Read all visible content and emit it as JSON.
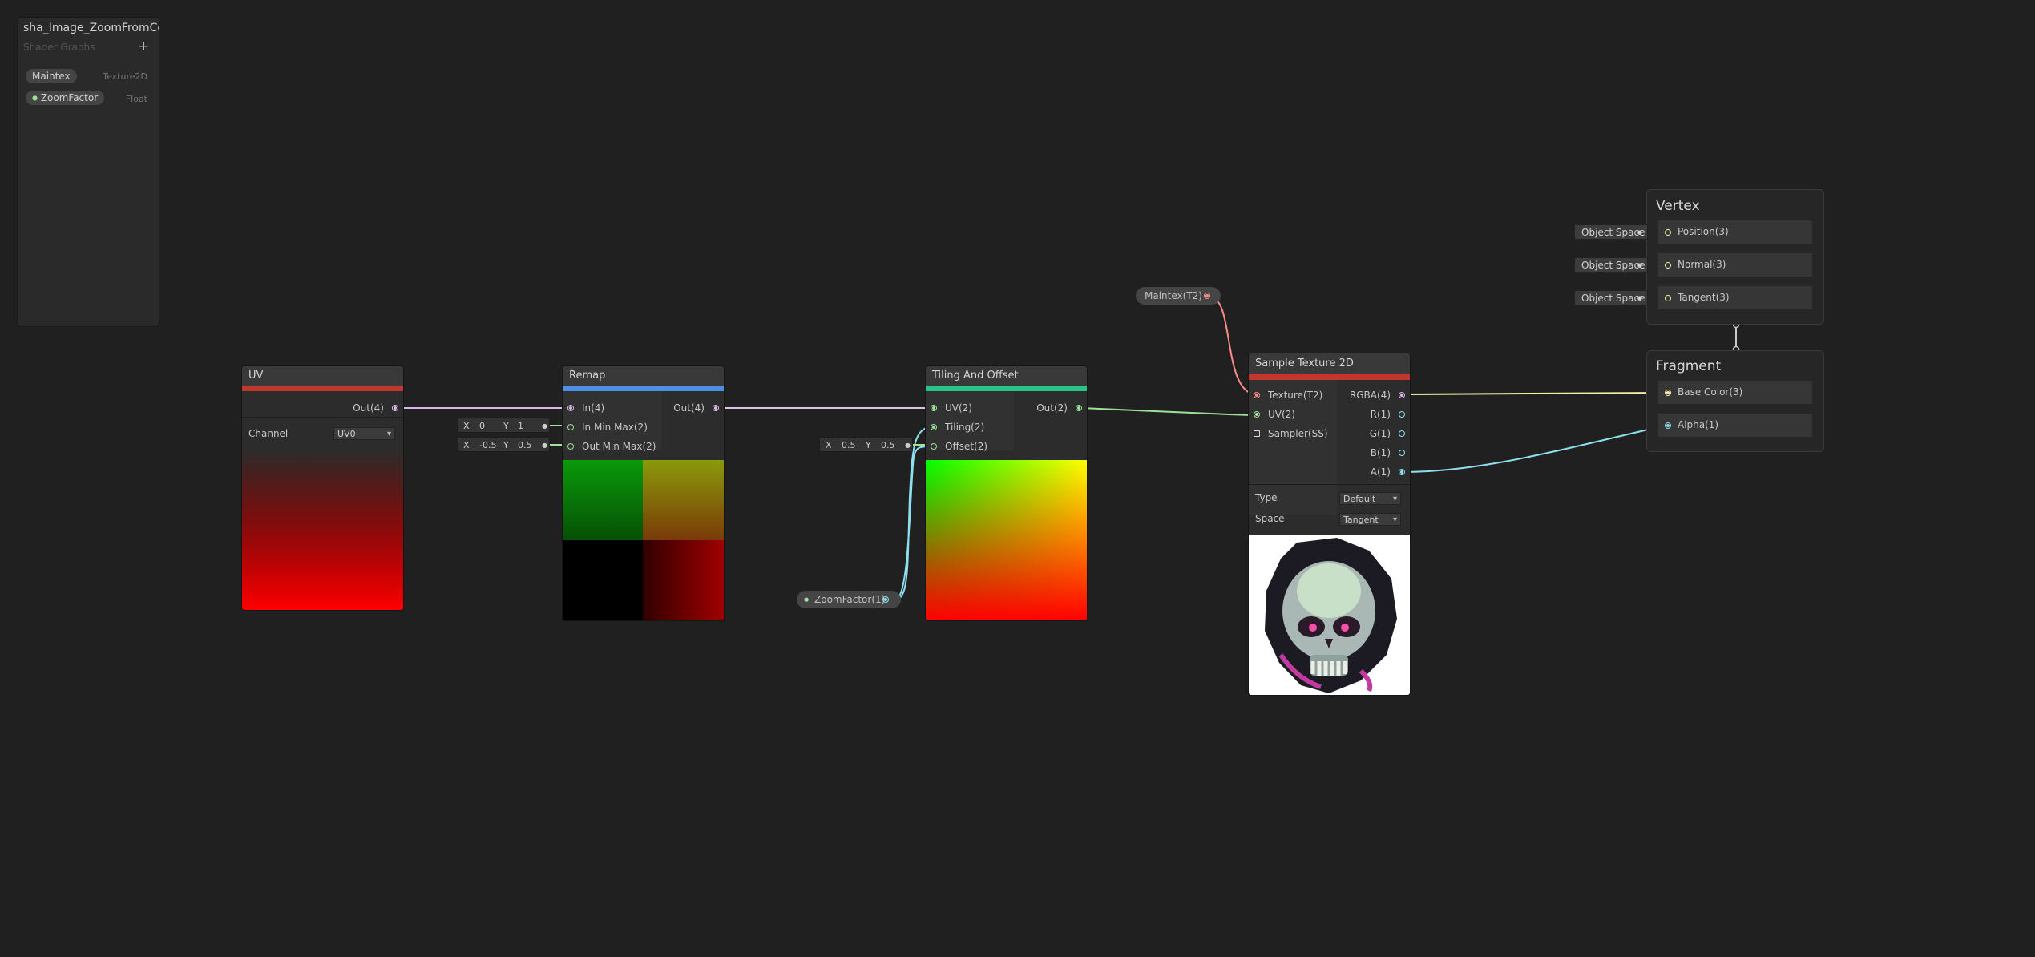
{
  "blackboard": {
    "title": "sha_Image_ZoomFromCenter",
    "subtitle": "Shader Graphs",
    "add_label": "+",
    "properties": [
      {
        "name": "Maintex",
        "type": "Texture2D"
      },
      {
        "name": "ZoomFactor",
        "type": "Float"
      }
    ]
  },
  "nodes": {
    "uv": {
      "title": "UV",
      "accent": "#c3362b",
      "out": "Out(4)",
      "channel_label": "Channel",
      "channel_value": "UV0"
    },
    "remap": {
      "title": "Remap",
      "accent": "#4f8ee6",
      "in": "In(4)",
      "in_min_max": "In Min Max(2)",
      "out_min_max": "Out Min Max(2)",
      "out": "Out(4)",
      "in_min_max_value": {
        "x_label": "X",
        "x": "0",
        "y_label": "Y",
        "y": "1"
      },
      "out_min_max_value": {
        "x_label": "X",
        "x": "-0.5",
        "y_label": "Y",
        "y": "0.5"
      }
    },
    "tiling": {
      "title": "Tiling And Offset",
      "accent": "#27c48a",
      "uv": "UV(2)",
      "tiling": "Tiling(2)",
      "offset": "Offset(2)",
      "out": "Out(2)",
      "offset_value": {
        "x_label": "X",
        "x": "0.5",
        "y_label": "Y",
        "y": "0.5"
      }
    },
    "sample": {
      "title": "Sample Texture 2D",
      "accent": "#c3362b",
      "inputs": [
        "Texture(T2)",
        "UV(2)",
        "Sampler(SS)"
      ],
      "outputs": [
        "RGBA(4)",
        "R(1)",
        "G(1)",
        "B(1)",
        "A(1)"
      ],
      "type_label": "Type",
      "type_value": "Default",
      "space_label": "Space",
      "space_value": "Tangent"
    }
  },
  "property_nodes": {
    "maintex": "Maintex(T2)",
    "zoom": "ZoomFactor(1)"
  },
  "master": {
    "vertex": {
      "title": "Vertex",
      "slots": [
        "Position(3)",
        "Normal(3)",
        "Tangent(3)"
      ],
      "space_label": "Object Space"
    },
    "fragment": {
      "title": "Fragment",
      "slots": [
        "Base Color(3)",
        "Alpha(1)"
      ]
    }
  },
  "colors": {
    "background": "#202020",
    "wire_vec4": "#d9b8e6",
    "wire_vec2": "#9ee29a",
    "wire_float": "#8fe0ee",
    "wire_texture": "#ff8a8a",
    "wire_vec3": "#f2f0a4"
  }
}
